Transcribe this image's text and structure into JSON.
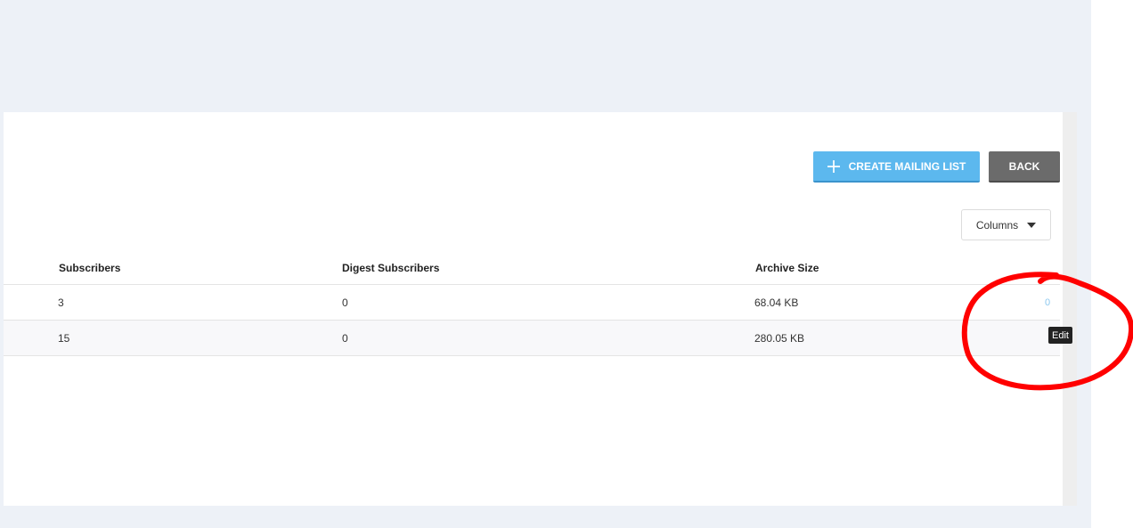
{
  "toolbar": {
    "create_label": "CREATE MAILING LIST",
    "back_label": "BACK",
    "columns_label": "Columns"
  },
  "table": {
    "headers": [
      "Subscribers",
      "Digest Subscribers",
      "Archive Size"
    ],
    "rows": [
      {
        "subscribers": "3",
        "digest_subscribers": "0",
        "archive_size": "68.04 KB"
      },
      {
        "subscribers": "15",
        "digest_subscribers": "0",
        "archive_size": "280.05 KB"
      }
    ],
    "edit_icon_glyph": "0",
    "edit_tooltip": "Edit"
  },
  "icons": {
    "create": "plus-icon",
    "columns": "caret-down-icon",
    "edit": "edit-icon"
  },
  "colors": {
    "background": "#edf1f7",
    "primary_button": "#5cb8ee",
    "back_button": "#6b6b6b",
    "annotation": "#ff0000"
  }
}
